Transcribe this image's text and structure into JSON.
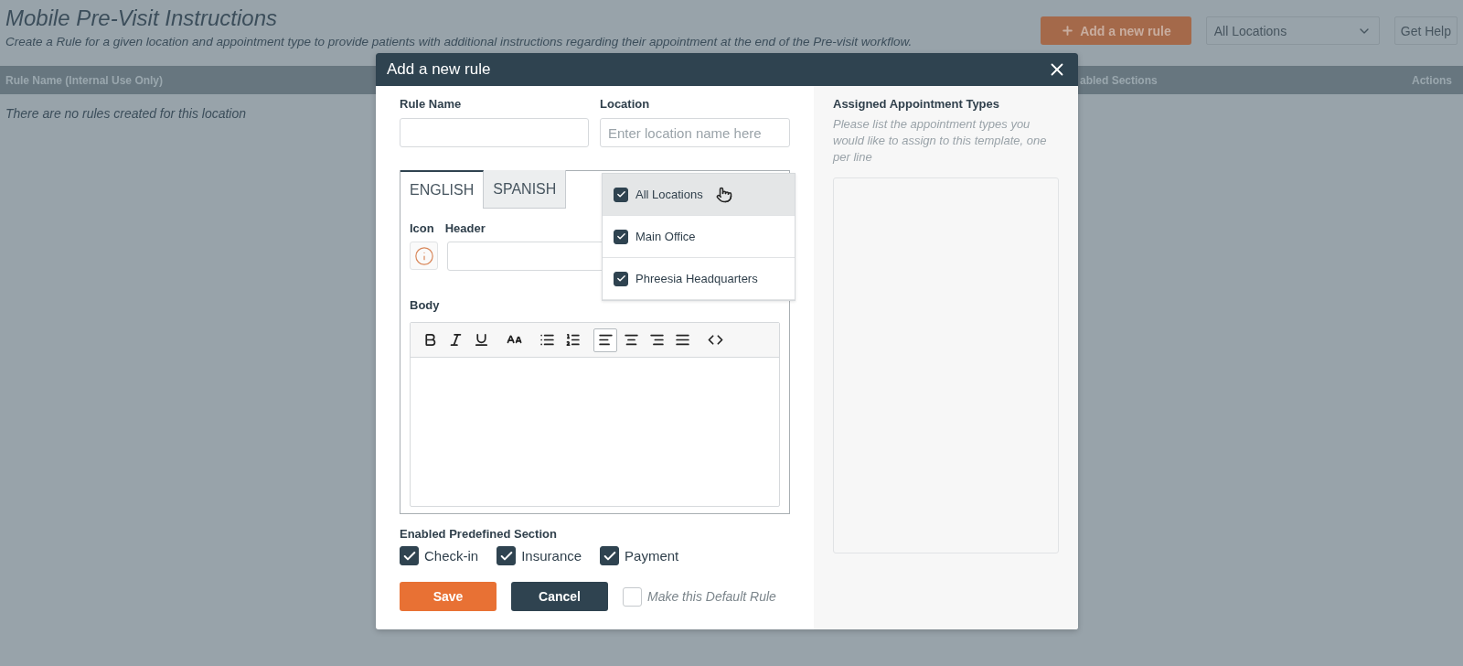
{
  "page": {
    "title": "Mobile Pre-Visit Instructions",
    "subtitle": "Create a Rule for a given location and appointment type to provide patients with additional instructions regarding their appointment at the end of the Pre-visit workflow.",
    "add_button": "Add a new rule",
    "location_select": "All Locations",
    "help_button": "Get Help"
  },
  "table": {
    "columns": [
      "Rule Name (Internal Use Only)",
      "abled Sections",
      "Actions"
    ],
    "empty_message": "There are no rules created for this location"
  },
  "modal": {
    "title": "Add a new rule",
    "rule_name_label": "Rule Name",
    "location_label": "Location",
    "location_placeholder": "Enter location name here",
    "location_options": [
      {
        "label": "All Locations",
        "checked": true,
        "highlighted": true
      },
      {
        "label": "Main Office",
        "checked": true,
        "highlighted": false
      },
      {
        "label": "Phreesia Headquarters",
        "checked": true,
        "highlighted": false
      }
    ],
    "tabs": [
      {
        "label": "ENGLISH",
        "selected": true
      },
      {
        "label": "SPANISH",
        "selected": false
      }
    ],
    "icon_label": "Icon",
    "header_label": "Header",
    "body_label": "Body",
    "toolbar": [
      {
        "kind": "bold",
        "selected": false
      },
      {
        "kind": "italic",
        "selected": false
      },
      {
        "kind": "underline",
        "selected": false
      },
      {
        "kind": "size",
        "selected": false
      },
      {
        "kind": "bullets",
        "selected": false
      },
      {
        "kind": "numbers",
        "selected": false
      },
      {
        "kind": "left",
        "selected": true
      },
      {
        "kind": "center",
        "selected": false
      },
      {
        "kind": "right",
        "selected": false
      },
      {
        "kind": "justify",
        "selected": false
      },
      {
        "kind": "code",
        "selected": false
      }
    ],
    "sections_label": "Enabled Predefined Section",
    "sections": [
      {
        "label": "Check-in",
        "checked": true
      },
      {
        "label": "Insurance",
        "checked": true
      },
      {
        "label": "Payment",
        "checked": true
      }
    ],
    "save_button": "Save",
    "cancel_button": "Cancel",
    "default_rule": {
      "label": "Make this Default Rule",
      "checked": false
    },
    "assigned_title": "Assigned Appointment Types",
    "assigned_hint": "Please list the appointment types you would like to assign to this template, one per line"
  }
}
